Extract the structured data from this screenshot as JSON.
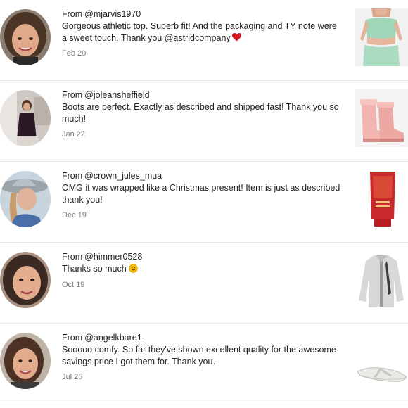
{
  "reviews": [
    {
      "from_label": "From",
      "handle": "@mjarvis1970",
      "text": "Gorgeous athletic top. Superb fit! And the packaging and TY note were a sweet touch. Thank you @astridcompany",
      "trailing_icon": "heart-icon",
      "date": "Feb 20",
      "product": "athletic-top"
    },
    {
      "from_label": "From",
      "handle": "@joleansheffield",
      "text": "Boots are perfect. Exactly as described and shipped fast! Thank you so much!",
      "date": "Jan 22",
      "product": "rain-boots"
    },
    {
      "from_label": "From",
      "handle": "@crown_jules_mua",
      "text": "OMG it was wrapped like a Christmas present! Item is just as described thank you!",
      "date": "Dec 19",
      "product": "cosmetic-tube"
    },
    {
      "from_label": "From",
      "handle": "@himmer0528",
      "text": "Thanks so much",
      "trailing_icon": "smile-emoji-icon",
      "date": "Oct 19",
      "product": "track-jacket"
    },
    {
      "from_label": "From",
      "handle": "@angelkbare1",
      "text": "Sooooo comfy. So far they've shown excellent quality for the awesome savings price I got them for. Thank you.",
      "date": "Jul 25",
      "product": "flip-flop"
    }
  ],
  "colors": {
    "text": "#222222",
    "date": "#777777",
    "divider": "#e6e6e6",
    "heart": "#d71920",
    "smile": "#f5b800"
  }
}
